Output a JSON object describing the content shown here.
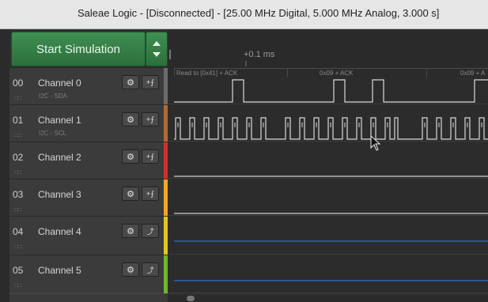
{
  "window": {
    "title": "Saleae Logic - [Disconnected] - [25.00 MHz Digital, 5.000 MHz Analog, 3.000 s]"
  },
  "start": {
    "label": "Start Simulation"
  },
  "timeline": {
    "label": "+0.1 ms"
  },
  "protocol": [
    {
      "text": "Read to [0x41] + ACK"
    },
    {
      "text": "0x09 + ACK"
    },
    {
      "text": "0x09 + A"
    }
  ],
  "channels": [
    {
      "num": "00",
      "name": "Channel 0",
      "sub": "I2C - SDA",
      "strip": "#6b6b6b",
      "trigger": "edge"
    },
    {
      "num": "01",
      "name": "Channel 1",
      "sub": "I2C - SCL",
      "strip": "#b06b34",
      "trigger": "edge"
    },
    {
      "num": "02",
      "name": "Channel 2",
      "sub": "",
      "strip": "#d32f2f",
      "trigger": "edge"
    },
    {
      "num": "03",
      "name": "Channel 3",
      "sub": "",
      "strip": "#f6a623",
      "trigger": "edge"
    },
    {
      "num": "04",
      "name": "Channel 4",
      "sub": "",
      "strip": "#e4c51d",
      "trigger": "analog"
    },
    {
      "num": "05",
      "name": "Channel 5",
      "sub": "",
      "strip": "#72b52e",
      "trigger": "analog"
    }
  ],
  "icons": {
    "gear": "gear-icon",
    "edge": "edge-trigger-icon",
    "analog": "analog-trigger-icon"
  },
  "colors": {
    "signal": "#d9d9d9",
    "analog_line": "#2f6ed8",
    "start_button": "#2e7d40"
  }
}
